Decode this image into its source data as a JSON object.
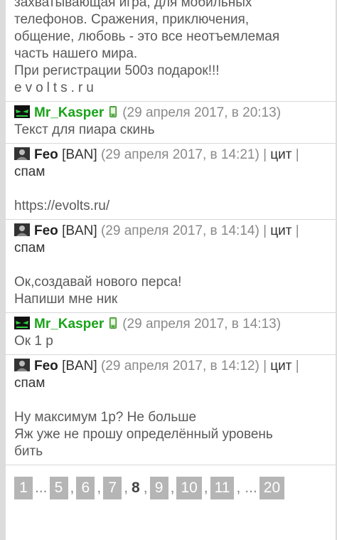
{
  "intro": {
    "lines": [
      "захватывающая игра, для мобильных",
      "телефонов. Сражения, приключения,",
      "общение, любовь - это все неотъемлемая",
      "часть нашего мира.",
      "При регистрации 500з подарок!!!",
      "evolts.ru"
    ]
  },
  "posts": [
    {
      "author": "Mr_Kasper",
      "date": "(29 апреля 2017, в 20:13)",
      "text": [
        "Текст для пиара скинь"
      ]
    },
    {
      "author": "Feo",
      "ban": "[BAN]",
      "date": "(29 апреля 2017, в 14:21)",
      "quote": "цит",
      "spam": "спам",
      "text": [
        "https://evolts.ru/"
      ]
    },
    {
      "author": "Feo",
      "ban": "[BAN]",
      "date": "(29 апреля 2017, в 14:14)",
      "quote": "цит",
      "spam": "спам",
      "text": [
        "Ок,создавай нового перса!",
        "Напиши мне ник"
      ]
    },
    {
      "author": "Mr_Kasper",
      "date": "(29 апреля 2017, в 14:13)",
      "text": [
        "Ок 1 р"
      ]
    },
    {
      "author": "Feo",
      "ban": "[BAN]",
      "date": "(29 апреля 2017, в 14:12)",
      "quote": "цит",
      "spam": "спам",
      "text": [
        "Ну максимум 1р? Не больше",
        "Яж уже не прошу определённый уровень",
        "бить"
      ]
    }
  ],
  "pager": {
    "pages": [
      "1",
      "5",
      "6",
      "7",
      "8",
      "9",
      "10",
      "11",
      "20"
    ],
    "current": "8",
    "ellipsis": "...",
    "comma": ","
  },
  "icons": {
    "kasper_avatar": "green-eyes-avatar-icon",
    "phone": "mobile-phone-icon",
    "feo_avatar": "person-avatar-icon"
  },
  "colors": {
    "kasper_name": "#1aa31a",
    "feo_name": "#222222",
    "pager_bg": "#b5b5b5"
  }
}
